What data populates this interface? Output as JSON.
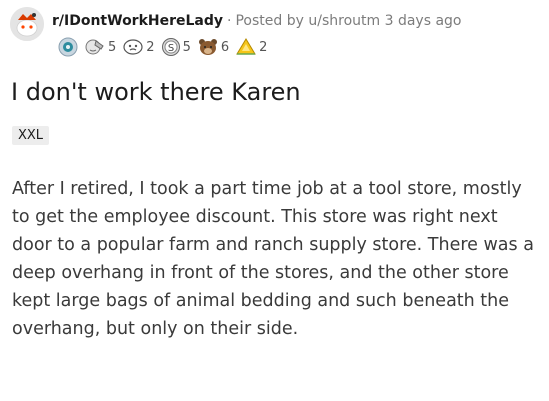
{
  "post": {
    "subreddit": "r/IDontWorkHereLady",
    "separator": "·",
    "posted_by_prefix": "Posted by",
    "username": "u/shroutm",
    "time_ago": "3 days ago",
    "title": "I don't work there Karen",
    "flair": "XXL",
    "body": "After I retired, I took a part time job at a tool store, mostly to get the employee discount. This store was right next door to a popular farm and ranch supply store. There was a deep overhang in front of the stores, and the other store kept large bags of animal bedding and such beneath the overhang, but only on their side."
  },
  "awards": [
    {
      "icon": "silver-award-icon",
      "count": ""
    },
    {
      "icon": "facepalm-award-icon",
      "count": "5"
    },
    {
      "icon": "face-award-icon",
      "count": "2"
    },
    {
      "icon": "coin-award-icon",
      "count": "5"
    },
    {
      "icon": "bear-award-icon",
      "count": "6"
    },
    {
      "icon": "gold-triangle-award-icon",
      "count": "2"
    }
  ],
  "colors": {
    "accent": "#ff4500",
    "meta_text": "#7c7c7c",
    "body_text": "#3a3a3a",
    "flair_bg": "#ededed"
  }
}
